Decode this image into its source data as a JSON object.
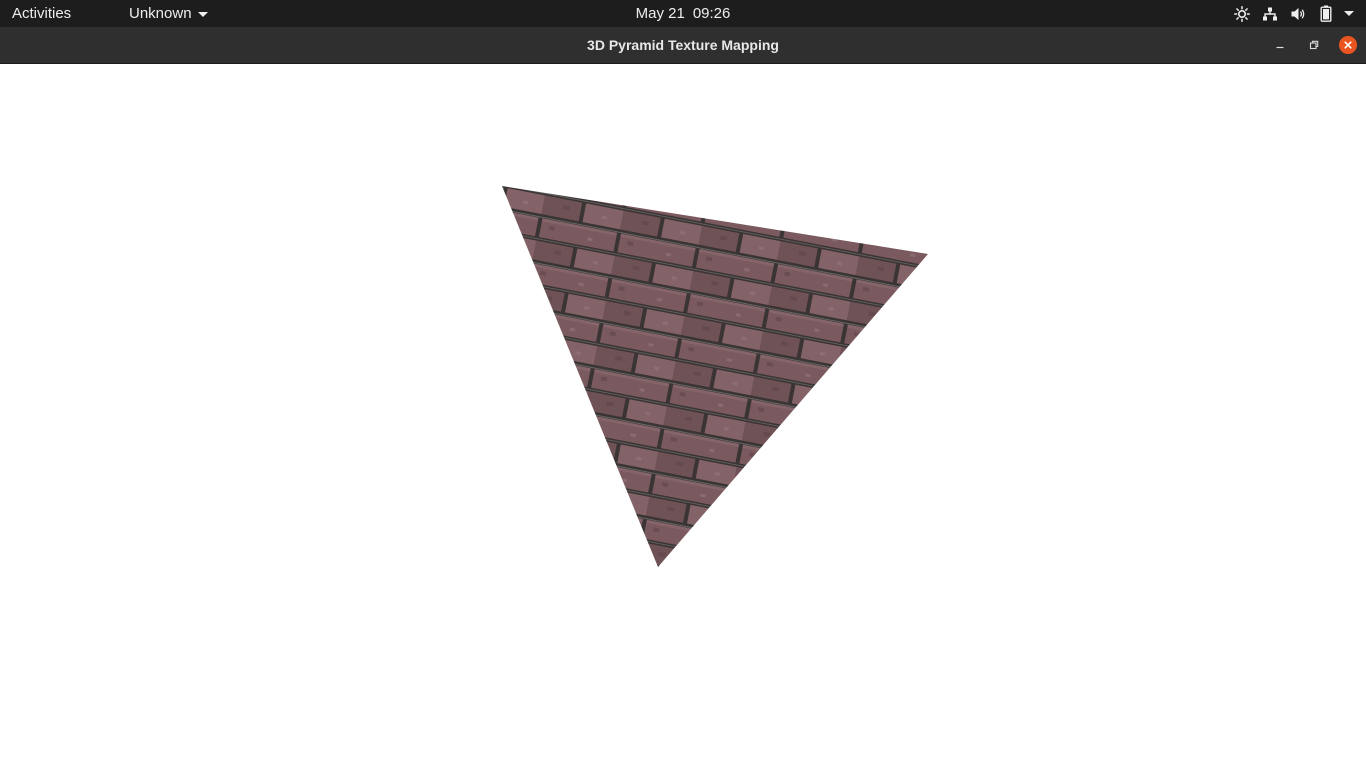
{
  "topbar": {
    "activities_label": "Activities",
    "app_menu_label": "Unknown",
    "clock_date": "May 21",
    "clock_time": "09:26",
    "status_icons": [
      "brightness-icon",
      "network-icon",
      "volume-icon",
      "battery-icon",
      "system-menu-caret-icon"
    ]
  },
  "window": {
    "title": "3D Pyramid Texture Mapping",
    "controls": [
      "minimize-icon",
      "maximize-icon",
      "close-icon"
    ],
    "accent_close_color": "#e95420"
  },
  "scene": {
    "background_color": "#ffffff",
    "texture": "brick",
    "brick_color": "#7a5a5e",
    "mortar_color": "#3a3434"
  }
}
